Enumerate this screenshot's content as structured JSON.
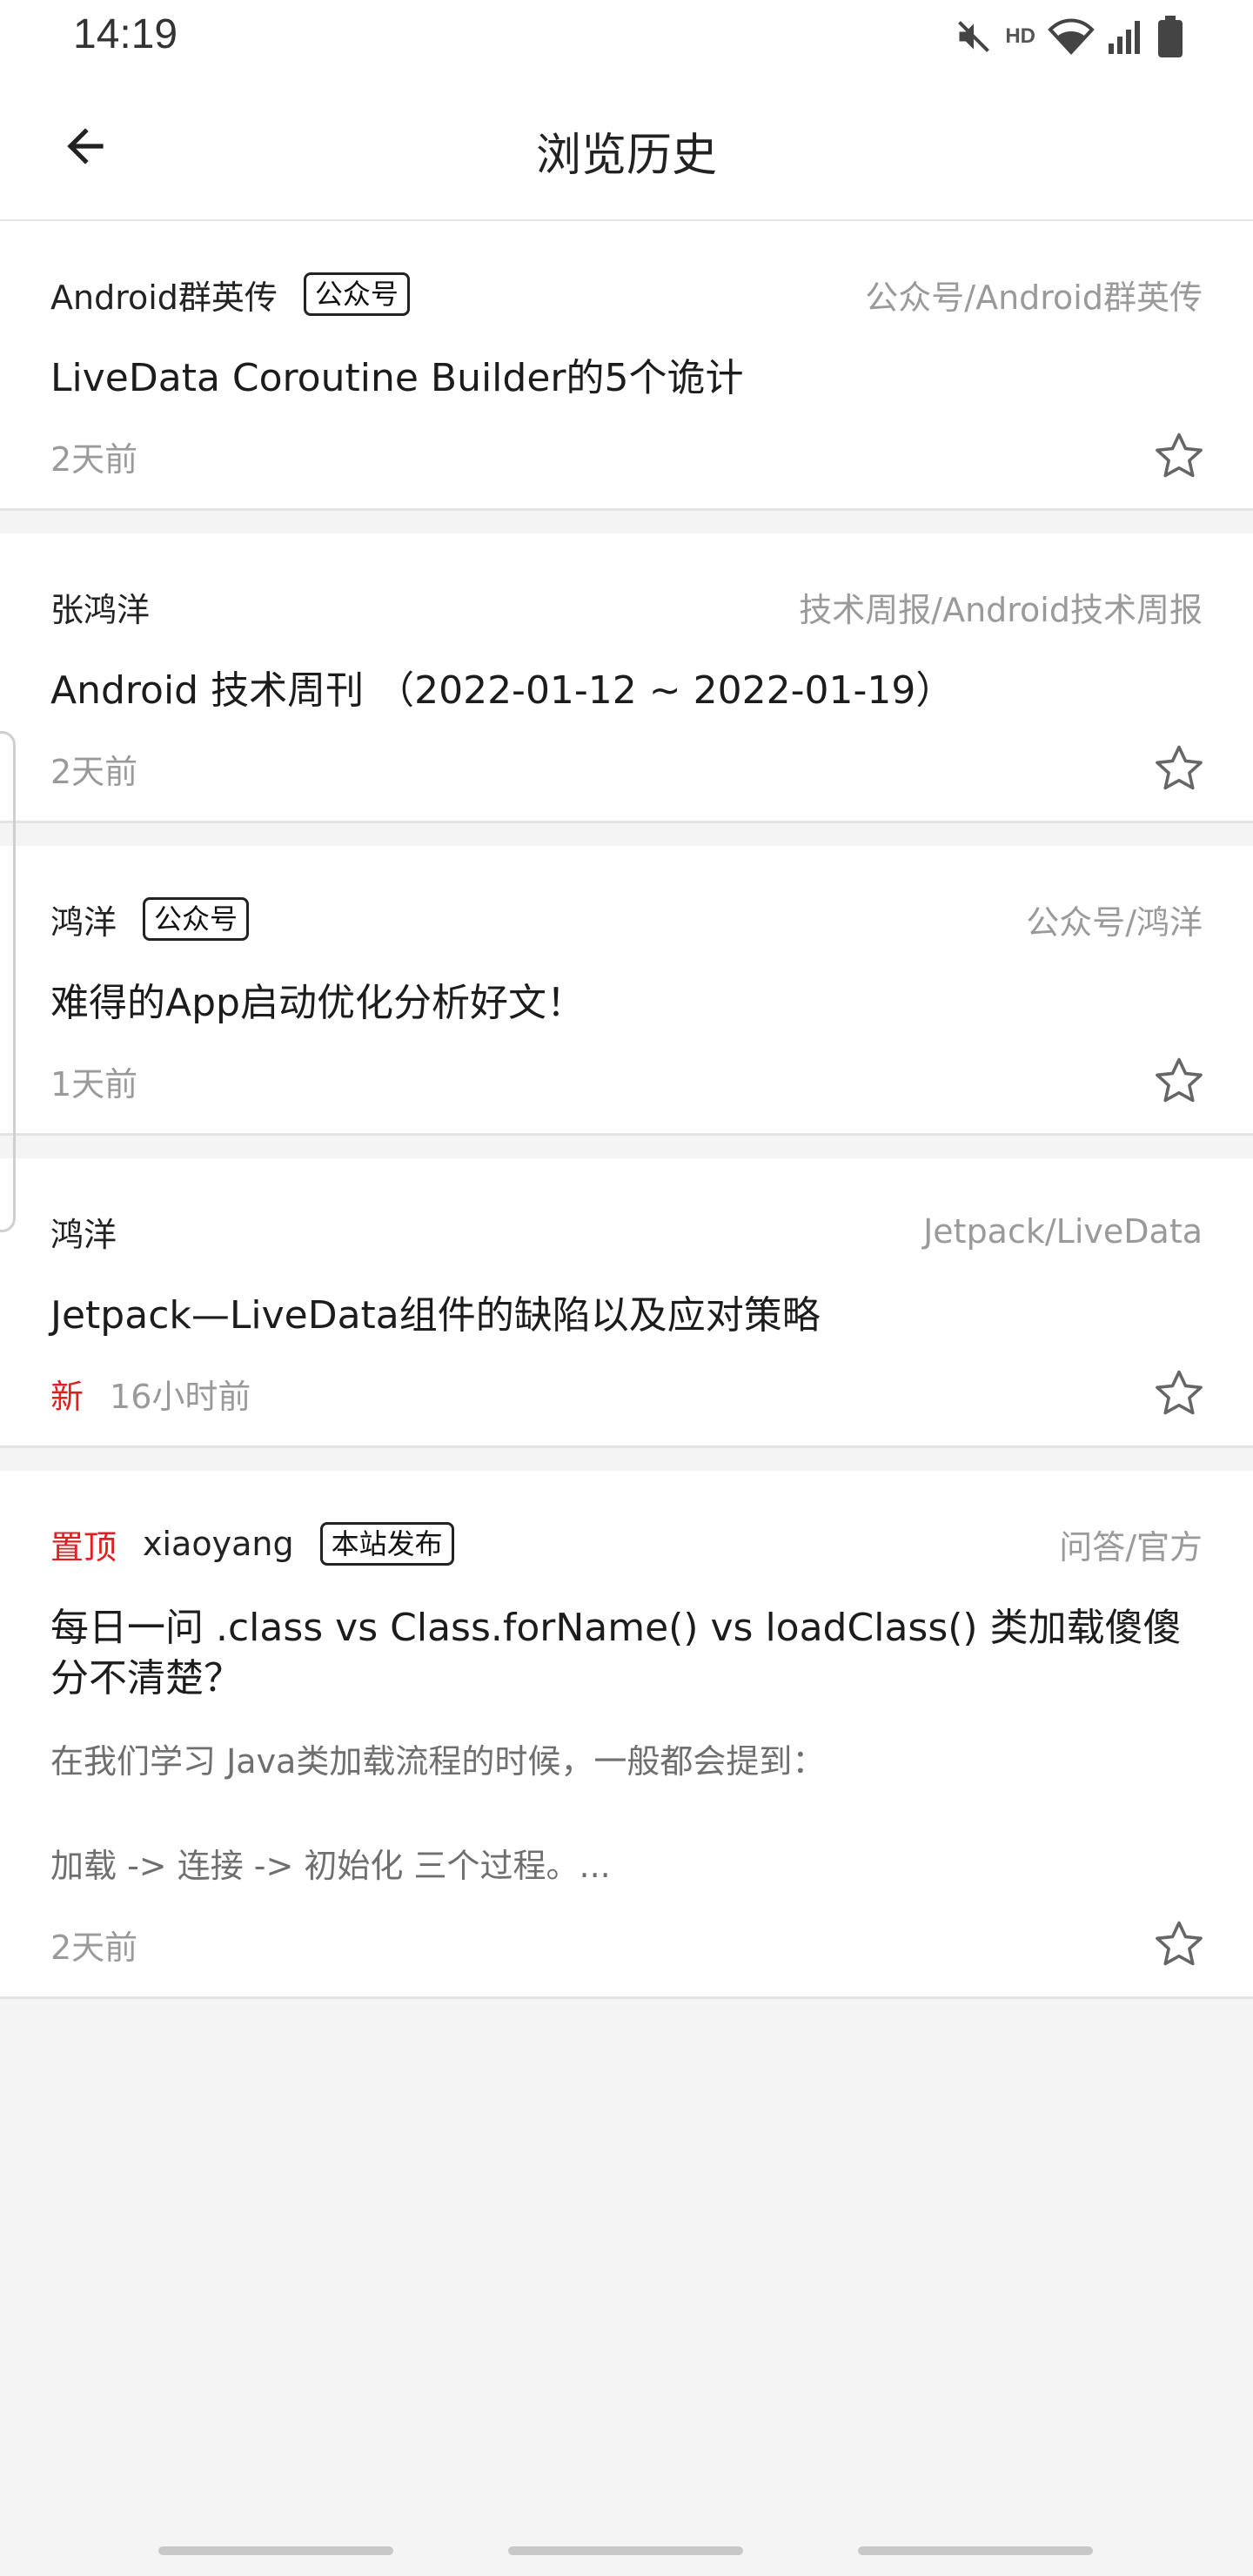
{
  "status_bar": {
    "time": "14:19",
    "hd": "HD"
  },
  "app_bar": {
    "title": "浏览历史"
  },
  "items": [
    {
      "author": "Android群英传",
      "tag": "公众号",
      "category": "公众号/Android群英传",
      "title": "LiveData Coroutine Builder的5个诡计",
      "time": "2天前"
    },
    {
      "author": "张鸿洋",
      "category": "技术周报/Android技术周报",
      "title": "Android 技术周刊 （2022-01-12 ~ 2022-01-19）",
      "time": "2天前"
    },
    {
      "author": "鸿洋",
      "tag": "公众号",
      "category": "公众号/鸿洋",
      "title": "难得的App启动优化分析好文！",
      "time": "1天前"
    },
    {
      "author": "鸿洋",
      "category": "Jetpack/LiveData",
      "title": "Jetpack—LiveData组件的缺陷以及应对策略",
      "new_label": "新",
      "time": "16小时前"
    },
    {
      "pin_label": "置顶",
      "author": "xiaoyang",
      "tag": "本站发布",
      "category": "问答/官方",
      "title": "每日一问 .class vs Class.forName() vs loadClass() 类加载傻傻分不清楚？",
      "description": "在我们学习 Java类加载流程的时候，一般都会提到：\n\n加载 -> 连接 -> 初始化 三个过程。...",
      "time": "2天前"
    }
  ],
  "colors": {
    "accent_red": "#e02020",
    "muted_text": "#9a9a9a",
    "background": "#f4f4f4"
  }
}
